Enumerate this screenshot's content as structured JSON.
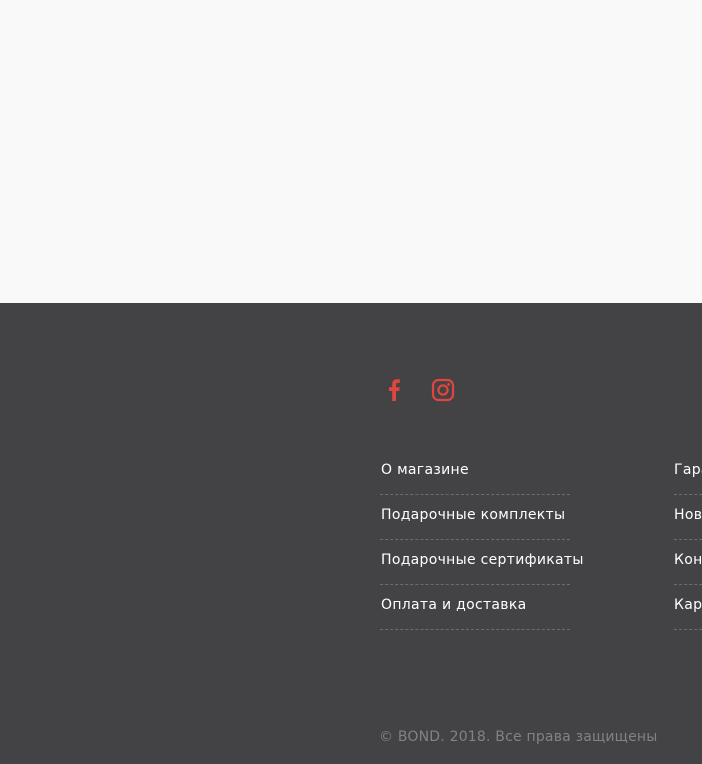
{
  "social": {
    "facebook_icon": "facebook-icon",
    "instagram_icon": "instagram-icon",
    "icon_color": "#e0463f"
  },
  "footer_menu": {
    "column1": [
      {
        "label": "О магазине"
      },
      {
        "label": "Подарочные комплекты"
      },
      {
        "label": "Подарочные сертификаты"
      },
      {
        "label": "Оплата и доставка"
      }
    ],
    "column2": [
      {
        "label": "Гара"
      },
      {
        "label": "Нов"
      },
      {
        "label": "Кон"
      },
      {
        "label": "Кар"
      }
    ]
  },
  "copyright": "© BOND. 2018. Все права защищены",
  "colors": {
    "page_background": "#f9f9f9",
    "footer_background": "#434345",
    "link_text": "#ffffff",
    "copyright_text": "#828285"
  }
}
